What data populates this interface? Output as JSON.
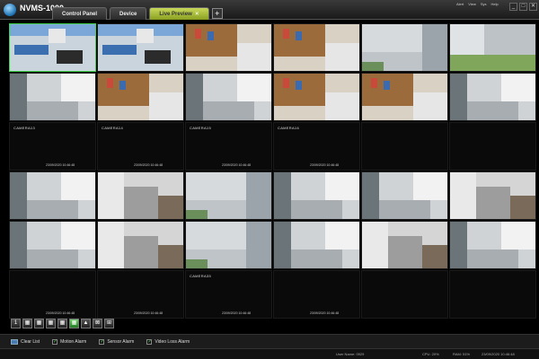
{
  "app": {
    "title": "NVMS-1000"
  },
  "tabs": [
    {
      "label": "Control Panel",
      "active": false
    },
    {
      "label": "Device",
      "active": false
    },
    {
      "label": "Live Preview",
      "active": true
    }
  ],
  "top_menu": [
    "Alert",
    "View",
    "Sys",
    "Help"
  ],
  "cameras": [
    {
      "title": "",
      "timestamp": ""
    },
    {
      "title": "",
      "timestamp": ""
    },
    {
      "title": "",
      "timestamp": ""
    },
    {
      "title": "",
      "timestamp": ""
    },
    {
      "title": "",
      "timestamp": ""
    },
    {
      "title": "",
      "timestamp": ""
    },
    {
      "title": "",
      "timestamp": ""
    },
    {
      "title": "",
      "timestamp": ""
    },
    {
      "title": "",
      "timestamp": ""
    },
    {
      "title": "",
      "timestamp": ""
    },
    {
      "title": "",
      "timestamp": ""
    },
    {
      "title": "",
      "timestamp": ""
    },
    {
      "title": "CAMERA13",
      "timestamp": "23/09/2020 10:46:48"
    },
    {
      "title": "CAMERA14",
      "timestamp": "23/09/2020 10:46:48"
    },
    {
      "title": "CAMERA15",
      "timestamp": "23/09/2020 10:46:48"
    },
    {
      "title": "CAMERA16",
      "timestamp": "23/09/2020 10:46:48"
    },
    {
      "title": "",
      "timestamp": ""
    },
    {
      "title": "",
      "timestamp": ""
    },
    {
      "title": "",
      "timestamp": ""
    },
    {
      "title": "",
      "timestamp": ""
    },
    {
      "title": "",
      "timestamp": ""
    },
    {
      "title": "",
      "timestamp": ""
    },
    {
      "title": "",
      "timestamp": ""
    },
    {
      "title": "",
      "timestamp": ""
    },
    {
      "title": "",
      "timestamp": ""
    },
    {
      "title": "",
      "timestamp": ""
    },
    {
      "title": "",
      "timestamp": ""
    },
    {
      "title": "",
      "timestamp": ""
    },
    {
      "title": "",
      "timestamp": ""
    },
    {
      "title": "",
      "timestamp": ""
    },
    {
      "title": "",
      "timestamp": "23/09/2020 10:46:48"
    },
    {
      "title": "",
      "timestamp": "23/09/2020 10:46:48"
    },
    {
      "title": "CAMERA35",
      "timestamp": "23/09/2020 10:46:48"
    },
    {
      "title": "",
      "timestamp": "23/09/2020 10:46:48"
    },
    {
      "title": "",
      "timestamp": ""
    },
    {
      "title": "",
      "timestamp": ""
    }
  ],
  "toolbar": {
    "buttons": [
      "1",
      "4",
      "9",
      "16",
      "25",
      "36",
      "full",
      "prev",
      "next"
    ]
  },
  "alarms": {
    "clear_label": "Clear List",
    "items": [
      "Motion Alarm",
      "Sensor Alarm",
      "Video Loss Alarm"
    ]
  },
  "status": {
    "user": "User Name: 0929",
    "cpu": "CPU: 20%",
    "ram": "RAM: 51%",
    "datetime": "23/09/2020 10:46:48"
  },
  "colors": {
    "selected_border": "#3fd24a",
    "active_tab": "#b6c83c"
  }
}
